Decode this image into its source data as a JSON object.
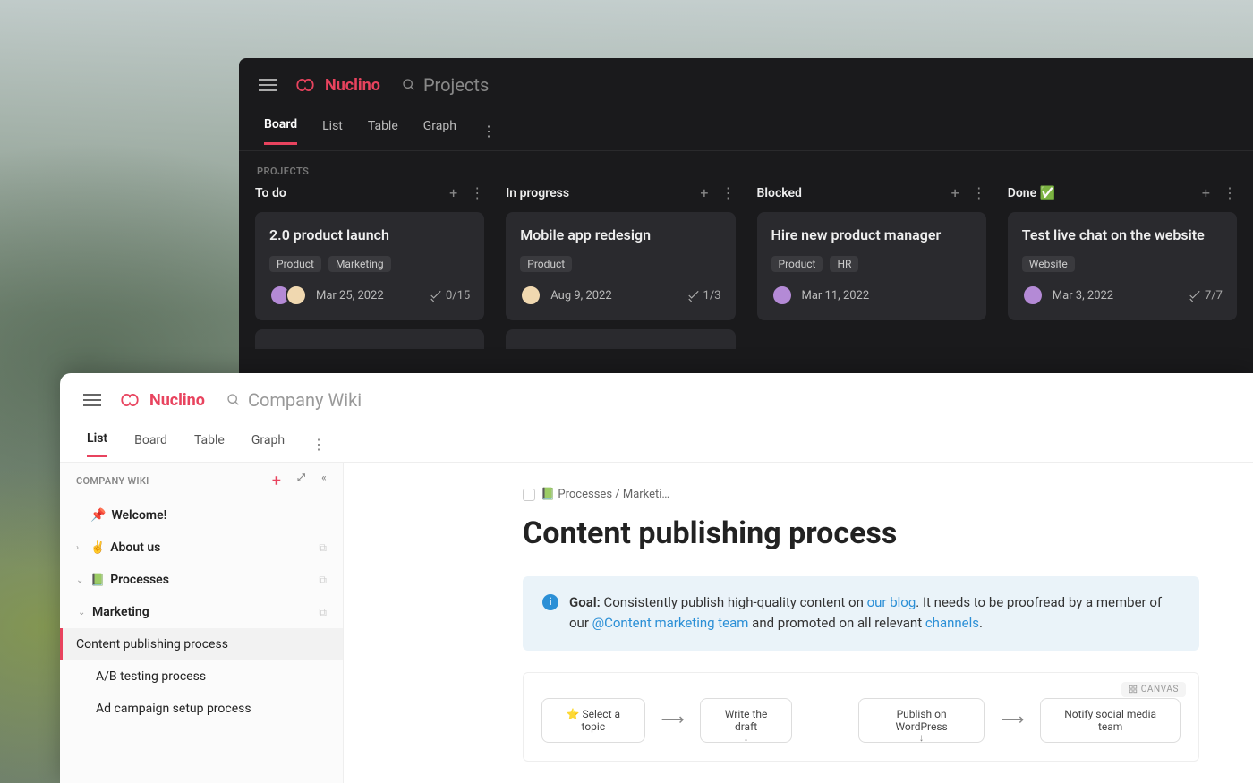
{
  "brand": "Nuclino",
  "dark": {
    "search_placeholder": "Projects",
    "tabs": [
      "Board",
      "List",
      "Table",
      "Graph"
    ],
    "active_tab_index": 0,
    "section_label": "PROJECTS",
    "columns": [
      {
        "title": "To do",
        "card": {
          "title": "2.0 product launch",
          "tags": [
            "Product",
            "Marketing"
          ],
          "date": "Mar 25, 2022",
          "check": "0/15",
          "avatars": [
            "#b48ad6",
            "#f0d8b0"
          ]
        }
      },
      {
        "title": "In progress",
        "card": {
          "title": "Mobile app redesign",
          "tags": [
            "Product"
          ],
          "date": "Aug 9, 2022",
          "check": "1/3",
          "avatars": [
            "#f0d8b0"
          ]
        }
      },
      {
        "title": "Blocked",
        "card": {
          "title": "Hire new product manager",
          "tags": [
            "Product",
            "HR"
          ],
          "date": "Mar 11, 2022",
          "check": "",
          "avatars": [
            "#b48ad6"
          ]
        }
      },
      {
        "title": "Done ✅",
        "card": {
          "title": "Test live chat on the website",
          "tags": [
            "Website"
          ],
          "date": "Mar 3, 2022",
          "check": "7/7",
          "avatars": [
            "#b48ad6"
          ]
        }
      }
    ]
  },
  "light": {
    "search_placeholder": "Company Wiki",
    "tabs": [
      "List",
      "Board",
      "Table",
      "Graph"
    ],
    "active_tab_index": 0,
    "side_label": "COMPANY WIKI",
    "tree": {
      "welcome": "Welcome!",
      "about": "About us",
      "processes": "Processes",
      "marketing": "Marketing",
      "items": [
        "Content publishing process",
        "A/B testing process",
        "Ad campaign setup process"
      ]
    },
    "breadcrumb": "📗 Processes / Marketi…",
    "page_title": "Content publishing process",
    "callout": {
      "goal_label": "Goal:",
      "text1": " Consistently publish high-quality content on ",
      "link1": "our blog",
      "text2": ". It needs to be proofread by a member of our ",
      "mention": "@Content marketing team",
      "text3": " and promoted on all relevant ",
      "link2": "channels",
      "text4": "."
    },
    "canvas_label": "CANVAS",
    "flow": [
      "⭐ Select a topic",
      "Write the draft",
      "Publish on WordPress",
      "Notify social media team"
    ]
  }
}
